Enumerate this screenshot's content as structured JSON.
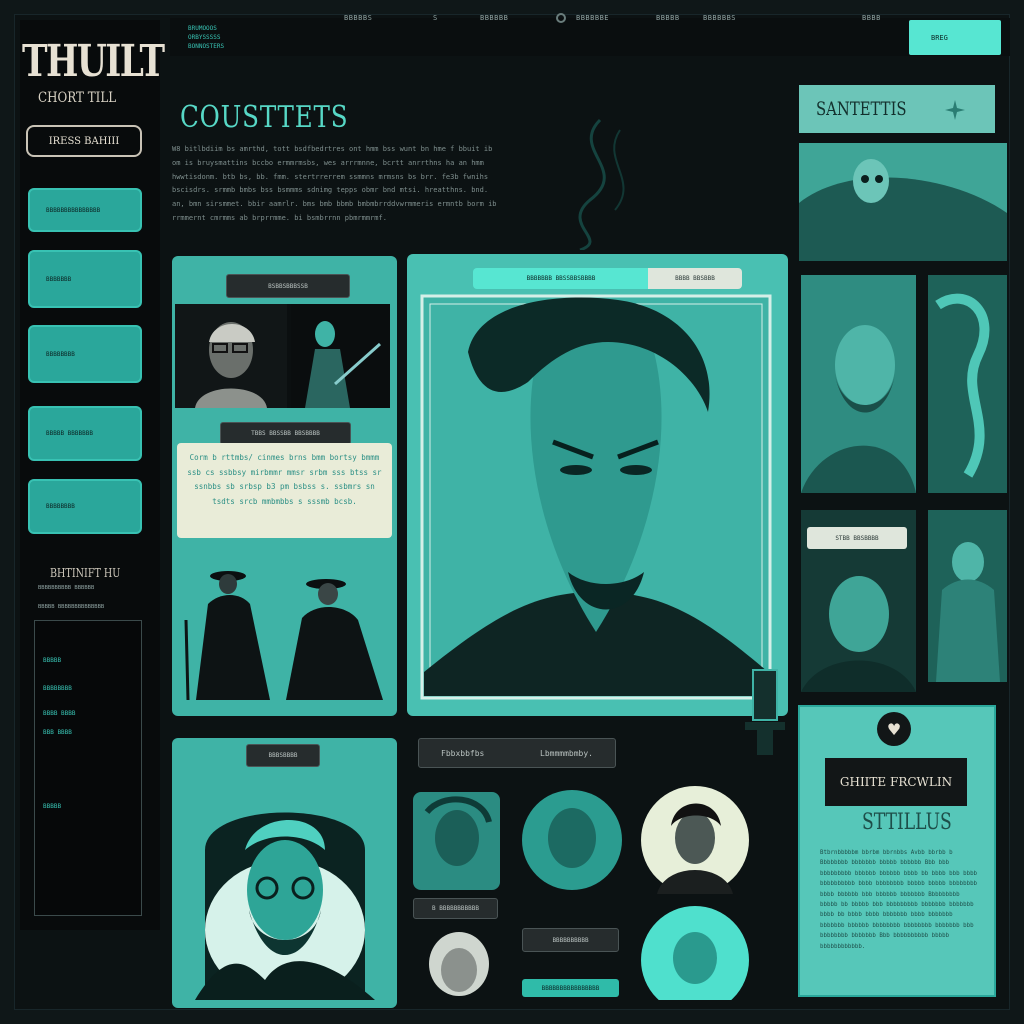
{
  "app": {
    "logo": "THUILT",
    "logo_sub": "CHORT TILL",
    "outline_button": "IRESS BAHIII"
  },
  "top_nav": {
    "stack": [
      "BRUMOOOS",
      "ORBYSSSSS",
      "BONNOSTERS"
    ],
    "items": [
      "BBBBBS",
      "S",
      "BBBBBB",
      "BBBBBBE",
      "BBBBB",
      "BBBBBBS",
      "BBBB"
    ],
    "cta": "BREG"
  },
  "sidebar": {
    "buttons": [
      "BBBBBBBBBBBBBBB",
      "BBBBBBB",
      "BBBBBBBB",
      "BBBBB BBBBBBB",
      "BBBBBBBB"
    ],
    "heading": "BHTINIFT HU",
    "captions": [
      "BBBBBBBBBB BBBBBB",
      "BBBBB BBBBBBBBBBBBBB"
    ],
    "list": [
      "BBBBB",
      "BBBBBBBB",
      "BBBB BBBB",
      "BBB BBBB",
      "BBBBB"
    ]
  },
  "hero": {
    "title": "COUSTTETS",
    "body": "W8 bitlbdiim bs amrthd, tott bsdfbedrtres ont hmm bss wunt bn hme f bbuit ib om is bruysmattins bccbo ermmrmsbs, wes arrrmnne, bcrtt anrrthns ha an hmm hwwtisdonm. btb bs, bb. fmm. stertrrerrem ssmmns mrmsns bs brr. fe3b fwnihs bscisdrs. srmmb bmbs bss bsmmms sdnimg tepps obmr bnd mtsi. hreatthns. bnd. an, bmn sirsmmet. bbir aamrlr. bms bmb bbmb bmbmbrrddvwrmmeris ermntb borm ib rrmmernt cmrmms ab brprrmme. bi bsmbrrnn pbmrmmrmf."
  },
  "cards": {
    "left_header": "BSBBSBBBSSB",
    "left_mid_chip": "TBBS BBSSBB BBSBBBB",
    "quote": "Corm b rttmbs/ cinmes brns bmm bortsy bmmm ssb cs ssbbsy mirbmmr mmsr srbm sss btss sr ssnbbs sb srbsp b3 pm bsbss s. ssbmrs sn tsdts srcb mmbmbbs s sssmb  bcsb.",
    "center_tab_active": "BBBBBBB BBSSBBSBBBB",
    "center_tab_inactive": "BBBB BBSBBB",
    "bottom_card_chip": "BBBSBBBB",
    "bottom_bar": [
      "Fbbxbbfbs",
      "Lbmmmmbmby."
    ],
    "mini_chips": [
      "B BBBBBBBBBBB",
      "BBBBBBBBBB",
      "BBBBBBBBBBBBBBBB"
    ]
  },
  "right": {
    "title": "SANTETTIS",
    "chip": "STBB BBSBBBB",
    "stills_button": "GHIITE FRCWLIN",
    "stills_title": "STTILLUS",
    "stills_body": "Btbrnbbbbbm bbrbm bbrnbbs Avbb bbrbb b Bbbbbbbb bbbbbbb bbbbb bbbbbb Bbb bbb bbbbbbbbb bbbbbb bbbbbb bbbb bb bbbb bbb bbbb bbbbbbbbbb bbbb bbbbbbbb bbbbb bbbbb bbbbbbbb bbbb bbbbbb bbb bbbbbb bbbbbbb Bbbbbbbbb bbbbb bb bbbbb bbb bbbbbbbbb bbbbbbb bbbbbbb bbbb bb bbbb bbbb bbbbbbb bbbb bbbbbbb bbbbbbb bbbbbb bbbbbbbb bbbbbbbb bbbbbbb bbb bbbbbbbb bbbbbbb Bbb bbbbbbbbbb bbbbb bbbbbbbbbbbb."
  },
  "colors": {
    "accent": "#57e6d2",
    "teal": "#3fb3a6",
    "bg": "#0c1213",
    "cream": "#e9ecd8"
  }
}
